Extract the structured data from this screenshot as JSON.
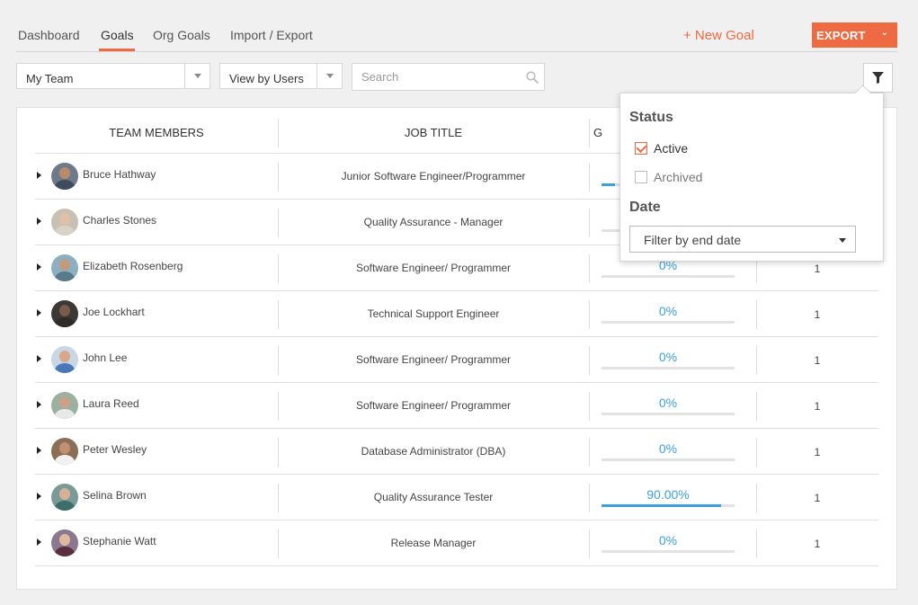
{
  "nav": {
    "tabs": [
      {
        "label": "Dashboard",
        "active": false
      },
      {
        "label": "Goals",
        "active": true
      },
      {
        "label": "Org Goals",
        "active": false
      },
      {
        "label": "Import / Export",
        "active": false
      }
    ],
    "new_goal_label": "+ New Goal",
    "export_label": "EXPORT",
    "export_chevron": "⌄"
  },
  "filters": {
    "team_select": "My Team",
    "view_select": "View by Users",
    "search_placeholder": "Search"
  },
  "table": {
    "headers": [
      "TEAM MEMBERS",
      "JOB TITLE",
      "G"
    ],
    "rows": [
      {
        "name": "Bruce Hathway",
        "job": "Junior Software Engineer/Programmer",
        "pct": "",
        "progress": 0.1,
        "count": ""
      },
      {
        "name": "Charles Stones",
        "job": "Quality Assurance - Manager",
        "pct": "",
        "progress": 0,
        "count": ""
      },
      {
        "name": "Elizabeth Rosenberg",
        "job": "Software Engineer/ Programmer",
        "pct": "0%",
        "progress": 0,
        "count": "1"
      },
      {
        "name": "Joe Lockhart",
        "job": "Technical Support Engineer",
        "pct": "0%",
        "progress": 0,
        "count": "1"
      },
      {
        "name": "John Lee",
        "job": "Software Engineer/ Programmer",
        "pct": "0%",
        "progress": 0,
        "count": "1"
      },
      {
        "name": "Laura Reed",
        "job": "Software Engineer/ Programmer",
        "pct": "0%",
        "progress": 0,
        "count": "1"
      },
      {
        "name": "Peter Wesley",
        "job": "Database Administrator (DBA)",
        "pct": "0%",
        "progress": 0,
        "count": "1"
      },
      {
        "name": "Selina Brown",
        "job": "Quality Assurance Tester",
        "pct": "90.00%",
        "progress": 0.9,
        "count": "1"
      },
      {
        "name": "Stephanie Watt",
        "job": "Release Manager",
        "pct": "0%",
        "progress": 0,
        "count": "1"
      }
    ]
  },
  "popover": {
    "status_heading": "Status",
    "active_label": "Active",
    "active_checked": true,
    "archived_label": "Archived",
    "archived_checked": false,
    "date_heading": "Date",
    "date_select": "Filter by end date"
  },
  "colors": {
    "accent": "#ee6a43",
    "progress": "#3aa0e0"
  },
  "avatars": [
    {
      "skin": "#b98a6c",
      "shirt": "#3e4c5e",
      "bg": "#6c7a8a"
    },
    {
      "skin": "#e0c0a8",
      "shirt": "#d9d2c8",
      "bg": "#c9c0b4"
    },
    {
      "skin": "#c49a7c",
      "shirt": "#5a7a8a",
      "bg": "#8ab0c2"
    },
    {
      "skin": "#7a5a48",
      "shirt": "#2e2a28",
      "bg": "#3b3835"
    },
    {
      "skin": "#d8a888",
      "shirt": "#4c78b8",
      "bg": "#c8d6e6"
    },
    {
      "skin": "#caa088",
      "shirt": "#e8e8e8",
      "bg": "#9ab0a0"
    },
    {
      "skin": "#c09070",
      "shirt": "#f2f2f2",
      "bg": "#8a6e58"
    },
    {
      "skin": "#d8b098",
      "shirt": "#3e6e6a",
      "bg": "#7a9a98"
    },
    {
      "skin": "#e0b8a0",
      "shirt": "#5a3040",
      "bg": "#8a7890"
    }
  ]
}
